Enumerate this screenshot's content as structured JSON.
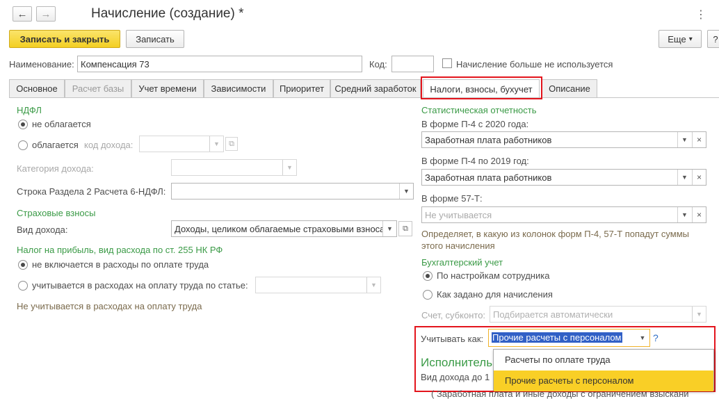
{
  "window": {
    "title": "Начисление (создание) *",
    "back_icon": "←",
    "forward_icon": "→",
    "more_icon": "⋮"
  },
  "toolbar": {
    "save_close": "Записать и закрыть",
    "save": "Записать",
    "more": "Еще",
    "more_arrow": "▾",
    "help": "?"
  },
  "header": {
    "name_label": "Наименование:",
    "name_value": "Компенсация 73",
    "code_label": "Код:",
    "code_value": "",
    "unused_label": "Начисление больше не используется"
  },
  "tabs": [
    {
      "label": "Основное"
    },
    {
      "label": "Расчет базы"
    },
    {
      "label": "Учет времени"
    },
    {
      "label": "Зависимости"
    },
    {
      "label": "Приоритет"
    },
    {
      "label": "Средний заработок"
    },
    {
      "label": "Налоги, взносы, бухучет"
    },
    {
      "label": "Описание"
    }
  ],
  "left": {
    "ndfl_group": "НДФЛ",
    "ndfl_not_taxed": "не облагается",
    "ndfl_taxed": "облагается",
    "income_code_label": "код дохода:",
    "income_category_label": "Категория дохода:",
    "section2_label": "Строка Раздела 2 Расчета 6-НДФЛ:",
    "insurance_group": "Страховые взносы",
    "income_type_label": "Вид дохода:",
    "income_type_value": "Доходы, целиком облагаемые страховыми взносами",
    "profit_group": "Налог на прибыль, вид расхода по ст. 255 НК РФ",
    "profit_not_included": "не включается в расходы по оплате труда",
    "profit_included": "учитывается в расходах на оплату труда по статье:",
    "profit_note": "Не учитывается в расходах на оплату труда"
  },
  "right": {
    "stat_group": "Статистическая отчетность",
    "p4_2020_label": "В форме П-4 с 2020 года:",
    "p4_2020_value": "Заработная плата работников",
    "p4_2019_label": "В форме П-4 по 2019 год:",
    "p4_2019_value": "Заработная плата работников",
    "f57_label": "В форме 57-Т:",
    "f57_placeholder": "Не учитывается",
    "stat_note_1": "Определяет, в какую из колонок форм П-4, 57-Т попадут суммы",
    "stat_note_2": "этого начисления",
    "accounting_group": "Бухгалтерский учет",
    "acc_by_employee": "По настройкам сотрудника",
    "acc_by_accrual": "Как задано для начисления",
    "account_label": "Счет, субконто:",
    "account_placeholder": "Подбирается автоматически",
    "account_as_label": "Учитывать как:",
    "account_as_value": "Прочие расчеты с персоналом",
    "help": "?",
    "exec_group": "Исполнительн",
    "exec_income_label": "Вид дохода до 1",
    "exec_bottom_value": "( Заработная плата и иные доходы с ограничением взыскани"
  },
  "dropdown": {
    "options": [
      "Расчеты по оплате труда",
      "Прочие расчеты с персоналом"
    ],
    "selected_index": 1
  },
  "colors": {
    "highlight": "#e3141c",
    "primary_button": "#f3cf22",
    "group_heading": "#3a9a46",
    "selected_option": "#f9cf26"
  }
}
